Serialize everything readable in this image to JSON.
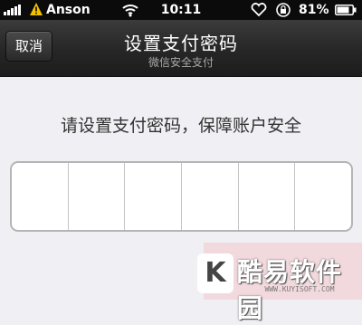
{
  "status_bar": {
    "carrier": "Anson",
    "time": "10:11",
    "battery_percent": "81%",
    "icons": [
      "signal-icon",
      "warning-icon",
      "wifi-icon",
      "heart-icon",
      "rotation-lock-icon",
      "battery-icon"
    ]
  },
  "nav": {
    "cancel_label": "取消",
    "title": "设置支付密码",
    "subtitle": "微信安全支付"
  },
  "prompt": "请设置支付密码，保障账户安全",
  "pin": {
    "length": 6,
    "filled": 0
  },
  "watermark": {
    "letter": "K",
    "text": "酷易软件园",
    "url": "WWW.KUYISOFT.COM"
  },
  "colors": {
    "navbar": "#262626",
    "background": "#efeff4",
    "text": "#333333",
    "pin_border": "#b5b5b5"
  }
}
